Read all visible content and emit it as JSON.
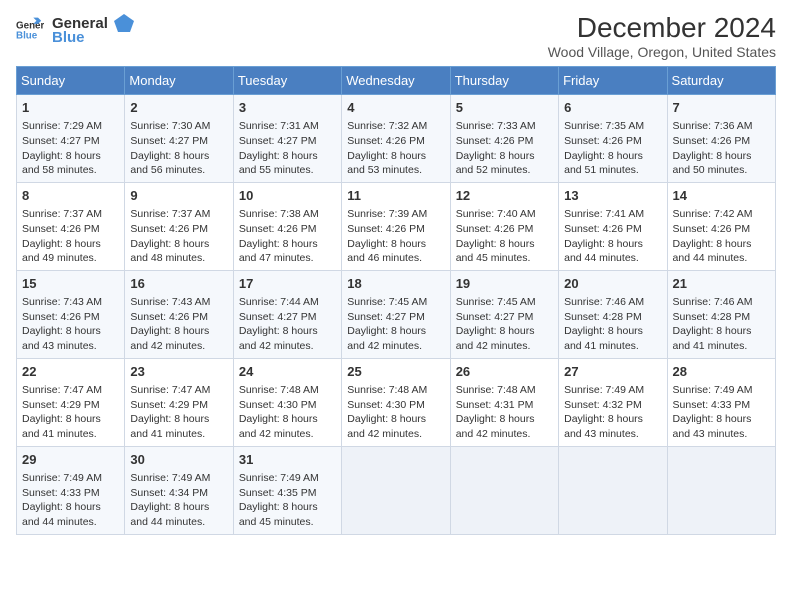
{
  "header": {
    "logo_line1": "General",
    "logo_line2": "Blue",
    "title": "December 2024",
    "subtitle": "Wood Village, Oregon, United States"
  },
  "days_of_week": [
    "Sunday",
    "Monday",
    "Tuesday",
    "Wednesday",
    "Thursday",
    "Friday",
    "Saturday"
  ],
  "weeks": [
    [
      {
        "day": "1",
        "sunrise": "Sunrise: 7:29 AM",
        "sunset": "Sunset: 4:27 PM",
        "daylight": "Daylight: 8 hours and 58 minutes."
      },
      {
        "day": "2",
        "sunrise": "Sunrise: 7:30 AM",
        "sunset": "Sunset: 4:27 PM",
        "daylight": "Daylight: 8 hours and 56 minutes."
      },
      {
        "day": "3",
        "sunrise": "Sunrise: 7:31 AM",
        "sunset": "Sunset: 4:27 PM",
        "daylight": "Daylight: 8 hours and 55 minutes."
      },
      {
        "day": "4",
        "sunrise": "Sunrise: 7:32 AM",
        "sunset": "Sunset: 4:26 PM",
        "daylight": "Daylight: 8 hours and 53 minutes."
      },
      {
        "day": "5",
        "sunrise": "Sunrise: 7:33 AM",
        "sunset": "Sunset: 4:26 PM",
        "daylight": "Daylight: 8 hours and 52 minutes."
      },
      {
        "day": "6",
        "sunrise": "Sunrise: 7:35 AM",
        "sunset": "Sunset: 4:26 PM",
        "daylight": "Daylight: 8 hours and 51 minutes."
      },
      {
        "day": "7",
        "sunrise": "Sunrise: 7:36 AM",
        "sunset": "Sunset: 4:26 PM",
        "daylight": "Daylight: 8 hours and 50 minutes."
      }
    ],
    [
      {
        "day": "8",
        "sunrise": "Sunrise: 7:37 AM",
        "sunset": "Sunset: 4:26 PM",
        "daylight": "Daylight: 8 hours and 49 minutes."
      },
      {
        "day": "9",
        "sunrise": "Sunrise: 7:37 AM",
        "sunset": "Sunset: 4:26 PM",
        "daylight": "Daylight: 8 hours and 48 minutes."
      },
      {
        "day": "10",
        "sunrise": "Sunrise: 7:38 AM",
        "sunset": "Sunset: 4:26 PM",
        "daylight": "Daylight: 8 hours and 47 minutes."
      },
      {
        "day": "11",
        "sunrise": "Sunrise: 7:39 AM",
        "sunset": "Sunset: 4:26 PM",
        "daylight": "Daylight: 8 hours and 46 minutes."
      },
      {
        "day": "12",
        "sunrise": "Sunrise: 7:40 AM",
        "sunset": "Sunset: 4:26 PM",
        "daylight": "Daylight: 8 hours and 45 minutes."
      },
      {
        "day": "13",
        "sunrise": "Sunrise: 7:41 AM",
        "sunset": "Sunset: 4:26 PM",
        "daylight": "Daylight: 8 hours and 44 minutes."
      },
      {
        "day": "14",
        "sunrise": "Sunrise: 7:42 AM",
        "sunset": "Sunset: 4:26 PM",
        "daylight": "Daylight: 8 hours and 44 minutes."
      }
    ],
    [
      {
        "day": "15",
        "sunrise": "Sunrise: 7:43 AM",
        "sunset": "Sunset: 4:26 PM",
        "daylight": "Daylight: 8 hours and 43 minutes."
      },
      {
        "day": "16",
        "sunrise": "Sunrise: 7:43 AM",
        "sunset": "Sunset: 4:26 PM",
        "daylight": "Daylight: 8 hours and 42 minutes."
      },
      {
        "day": "17",
        "sunrise": "Sunrise: 7:44 AM",
        "sunset": "Sunset: 4:27 PM",
        "daylight": "Daylight: 8 hours and 42 minutes."
      },
      {
        "day": "18",
        "sunrise": "Sunrise: 7:45 AM",
        "sunset": "Sunset: 4:27 PM",
        "daylight": "Daylight: 8 hours and 42 minutes."
      },
      {
        "day": "19",
        "sunrise": "Sunrise: 7:45 AM",
        "sunset": "Sunset: 4:27 PM",
        "daylight": "Daylight: 8 hours and 42 minutes."
      },
      {
        "day": "20",
        "sunrise": "Sunrise: 7:46 AM",
        "sunset": "Sunset: 4:28 PM",
        "daylight": "Daylight: 8 hours and 41 minutes."
      },
      {
        "day": "21",
        "sunrise": "Sunrise: 7:46 AM",
        "sunset": "Sunset: 4:28 PM",
        "daylight": "Daylight: 8 hours and 41 minutes."
      }
    ],
    [
      {
        "day": "22",
        "sunrise": "Sunrise: 7:47 AM",
        "sunset": "Sunset: 4:29 PM",
        "daylight": "Daylight: 8 hours and 41 minutes."
      },
      {
        "day": "23",
        "sunrise": "Sunrise: 7:47 AM",
        "sunset": "Sunset: 4:29 PM",
        "daylight": "Daylight: 8 hours and 41 minutes."
      },
      {
        "day": "24",
        "sunrise": "Sunrise: 7:48 AM",
        "sunset": "Sunset: 4:30 PM",
        "daylight": "Daylight: 8 hours and 42 minutes."
      },
      {
        "day": "25",
        "sunrise": "Sunrise: 7:48 AM",
        "sunset": "Sunset: 4:30 PM",
        "daylight": "Daylight: 8 hours and 42 minutes."
      },
      {
        "day": "26",
        "sunrise": "Sunrise: 7:48 AM",
        "sunset": "Sunset: 4:31 PM",
        "daylight": "Daylight: 8 hours and 42 minutes."
      },
      {
        "day": "27",
        "sunrise": "Sunrise: 7:49 AM",
        "sunset": "Sunset: 4:32 PM",
        "daylight": "Daylight: 8 hours and 43 minutes."
      },
      {
        "day": "28",
        "sunrise": "Sunrise: 7:49 AM",
        "sunset": "Sunset: 4:33 PM",
        "daylight": "Daylight: 8 hours and 43 minutes."
      }
    ],
    [
      {
        "day": "29",
        "sunrise": "Sunrise: 7:49 AM",
        "sunset": "Sunset: 4:33 PM",
        "daylight": "Daylight: 8 hours and 44 minutes."
      },
      {
        "day": "30",
        "sunrise": "Sunrise: 7:49 AM",
        "sunset": "Sunset: 4:34 PM",
        "daylight": "Daylight: 8 hours and 44 minutes."
      },
      {
        "day": "31",
        "sunrise": "Sunrise: 7:49 AM",
        "sunset": "Sunset: 4:35 PM",
        "daylight": "Daylight: 8 hours and 45 minutes."
      },
      null,
      null,
      null,
      null
    ]
  ]
}
